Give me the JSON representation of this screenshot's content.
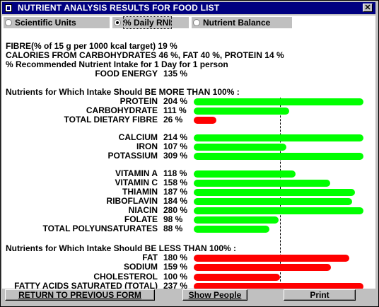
{
  "window": {
    "title": "NUTRIENT ANALYSIS RESULTS FOR FOOD LIST",
    "close": "✕"
  },
  "radios": [
    {
      "label": "Scientific Units",
      "selected": false
    },
    {
      "label": "% Daily RNI",
      "selected": true
    },
    {
      "label": "Nutrient Balance",
      "selected": false
    }
  ],
  "header_lines": {
    "fibre": "FIBRE(% of 15 g per 1000 kcal target)  19 %",
    "calories": "CALORIES FROM CARBOHYDRATES  46  %, FAT  40 %, PROTEIN  14  %",
    "rni": "% Recommended Nutrient Intake for  1  Day   for  1 person",
    "food_energy_label": "FOOD ENERGY",
    "food_energy_value": "135 %"
  },
  "more_heading": "Nutrients for Which Intake Should BE MORE THAN 100% :",
  "less_heading": "Nutrients for Which Intake Should BE LESS THAN 100% :",
  "colors": {
    "good": "#00ff00",
    "bad": "#ff0000"
  },
  "more_groups": [
    [
      {
        "name": "PROTEIN",
        "value": "204 %",
        "pct": 204,
        "color": "green"
      },
      {
        "name": "CARBOHYDRATE",
        "value": "111 %",
        "pct": 111,
        "color": "green"
      },
      {
        "name": "TOTAL DIETARY FIBRE",
        "value": "26 %",
        "pct": 26,
        "color": "red"
      }
    ],
    [
      {
        "name": "CALCIUM",
        "value": "214 %",
        "pct": 214,
        "color": "green"
      },
      {
        "name": "IRON",
        "value": "107 %",
        "pct": 107,
        "color": "green"
      },
      {
        "name": "POTASSIUM",
        "value": "309 %",
        "pct": 309,
        "color": "green"
      }
    ],
    [
      {
        "name": "VITAMIN A",
        "value": "118 %",
        "pct": 118,
        "color": "green"
      },
      {
        "name": "VITAMIN C",
        "value": "158 %",
        "pct": 158,
        "color": "green"
      },
      {
        "name": "THIAMIN",
        "value": "187 %",
        "pct": 187,
        "color": "green"
      },
      {
        "name": "RIBOFLAVIN",
        "value": "184 %",
        "pct": 184,
        "color": "green"
      },
      {
        "name": "NIACIN",
        "value": "280 %",
        "pct": 280,
        "color": "green"
      },
      {
        "name": "FOLATE",
        "value": "98 %",
        "pct": 98,
        "color": "green"
      },
      {
        "name": "TOTAL POLYUNSATURATES",
        "value": "88 %",
        "pct": 88,
        "color": "green"
      }
    ]
  ],
  "less_items": [
    {
      "name": "FAT",
      "value": "180 %",
      "pct": 180,
      "color": "red"
    },
    {
      "name": "SODIUM",
      "value": "159 %",
      "pct": 159,
      "color": "red"
    },
    {
      "name": "CHOLESTEROL",
      "value": "100 %",
      "pct": 100,
      "color": "red"
    },
    {
      "name": "FATTY ACIDS SATURATED (TOTAL)",
      "value": "237 %",
      "pct": 237,
      "color": "red"
    }
  ],
  "buttons": {
    "return": "RETURN TO PREVIOUS FORM",
    "show_people": "Show People",
    "print": "Print"
  }
}
